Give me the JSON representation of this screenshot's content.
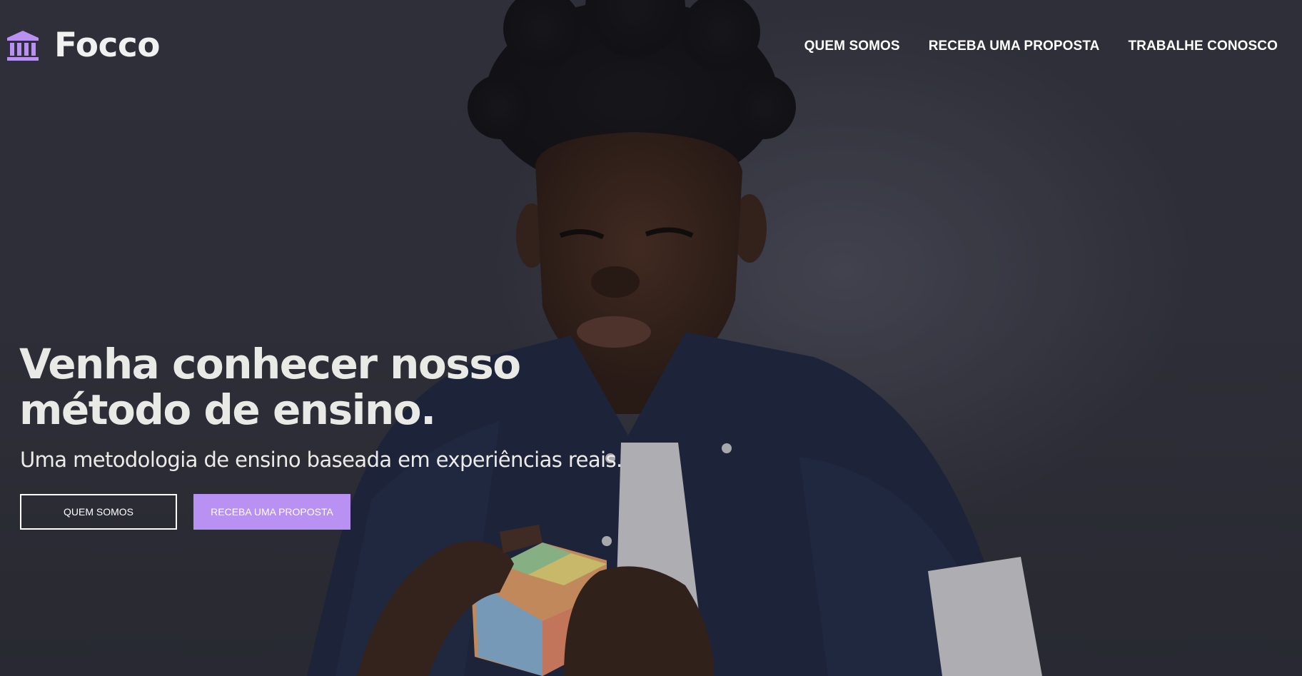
{
  "brand": {
    "name": "Focco",
    "icon": "bank-building-icon",
    "accent_color": "#b991f2"
  },
  "nav": {
    "items": [
      {
        "label": "QUEM SOMOS"
      },
      {
        "label": "RECEBA UMA PROPOSTA"
      },
      {
        "label": "TRABALHE CONOSCO"
      }
    ]
  },
  "hero": {
    "headline_line1": "Venha conhecer nosso",
    "headline_line2": "método de ensino.",
    "subtitle": "Uma metodologia de ensino baseada em experiências reais.",
    "button_primary": "QUEM SOMOS",
    "button_secondary": "RECEBA UMA PROPOSTA",
    "background_image": "teen-solving-rubiks-cube-photo"
  }
}
